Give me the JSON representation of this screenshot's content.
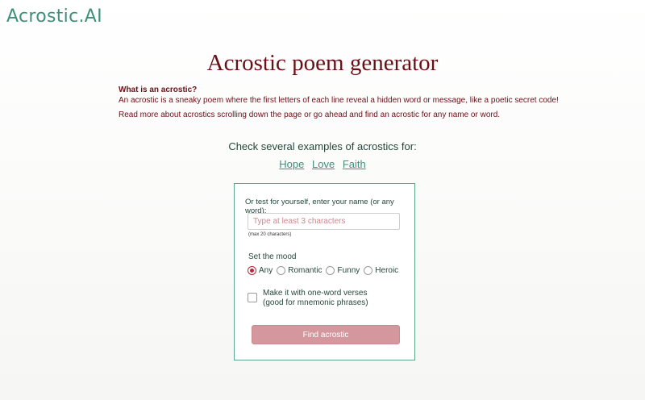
{
  "header": {
    "logo": "Acrostic.AI"
  },
  "main": {
    "title": "Acrostic poem generator",
    "intro": {
      "heading": "What is an acrostic?",
      "definition": "An acrostic is a sneaky poem where the first letters of each line reveal a hidden word or message, like a poetic secret code!",
      "read_more": "Read more about acrostics scrolling down the page or go ahead and find an acrostic for any name or word."
    },
    "examples": {
      "label": "Check several examples of acrostics for:",
      "links": [
        "Hope",
        "Love",
        "Faith"
      ]
    }
  },
  "form": {
    "prompt": "Or test for yourself, enter your name (or any word):",
    "input_placeholder": "Type at least 3 characters",
    "input_value": "",
    "max_hint": "(max 20 characters)",
    "mood_label": "Set the mood",
    "moods": [
      "Any",
      "Romantic",
      "Funny",
      "Heroic"
    ],
    "selected_mood": "Any",
    "checkbox_line1": "Make it with one-word verses",
    "checkbox_line2": "(good for mnemonic phrases)",
    "checkbox_checked": false,
    "submit_label": "Find acrostic"
  },
  "colors": {
    "title": "#6b0f17",
    "accent_green": "#3f8f7a",
    "button_disabled": "#d4979d",
    "radio_selected": "#b4283a"
  }
}
